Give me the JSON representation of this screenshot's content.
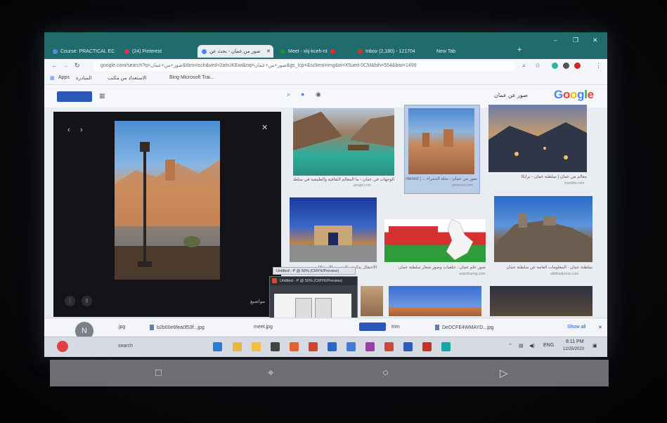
{
  "browser": {
    "tabs": [
      {
        "label": "Course: PRACTICAL EC",
        "color": "#5a8fd6"
      },
      {
        "label": "(24) Pinterest",
        "color": "#e0314b"
      },
      {
        "label": "صور من عمان - بحث عن",
        "color": "#4a86e8"
      },
      {
        "label": "Meet - xkj-kceh-nt",
        "color": "#1e8e3e"
      },
      {
        "label": "Inbox (2,180) - 121704",
        "color": "#d93025"
      },
      {
        "label": "New Tab",
        "color": "#1f6b6e"
      }
    ],
    "new_tab_symbol": "+",
    "window_controls": [
      "–",
      "❐",
      "✕"
    ],
    "url": "google.com/search?q=صور+من+عمان&tbm=isch&ved=2ahUKEwi&oq=صور+من+عمان&gs_lcp=&sclient=img&ei=X5ued-0CM&bih=554&biw=1499",
    "bookmarks": [
      "Apps",
      "المبادرة",
      "الاستعداد من مكتب",
      "Bing Microsoft Trai..."
    ]
  },
  "google": {
    "logo": "Google",
    "query": "صور عن عمان",
    "logo_colors": [
      "#4285F4",
      "#EA4335",
      "#FBBC05",
      "#4285F4",
      "#34A853",
      "#EA4335"
    ]
  },
  "preview": {
    "caption": "مواضيع",
    "close": "✕",
    "prev": "‹",
    "next": "›"
  },
  "results": [
    {
      "caption": "الوجهات في عمان - ما المعالم الثقافية والطبيعية في سلطنة",
      "source": "arrajol.com"
    },
    {
      "caption": "صور من عمان - نخلة الحمراء ... | Pinterest",
      "source": "pinterest.com"
    },
    {
      "caption": "معالم من عمان | سلطنة عمان - ترايكا",
      "source": "traveller.com"
    },
    {
      "caption": "الاحتفال بذكرى ولادة يوم الاستقلال",
      "source": "alkhaleej.ae"
    },
    {
      "caption": "صور علم عمان ، خلفيات وصور شعار سلطنة عمان",
      "source": "arabsharing.com"
    },
    {
      "caption": "سلطنة عمان - المعلومات العامة عن سلطنة عمان",
      "source": "alittihadpress.com"
    }
  ],
  "popup": {
    "tooltip": "Untitled - P @ 50% (CMYK/Preview)",
    "title": "Untitled - P @ 50% (CMYK/Preview)"
  },
  "downloads": {
    "items": [
      ".jpg",
      "b2b00e6fea0f53f...jpg",
      "meet.jpg",
      "trim",
      "DeDCFE4WMAYD...jpg"
    ],
    "show_all": "Show all",
    "close": "✕"
  },
  "avatar_letter": "N",
  "taskbar": {
    "search": "search",
    "time": "8:11 PM",
    "date": "12/25/2020",
    "lang": "ENG"
  },
  "android_nav": {
    "square": "□",
    "screenshot": "⌖",
    "home": "○",
    "back": "▷"
  }
}
